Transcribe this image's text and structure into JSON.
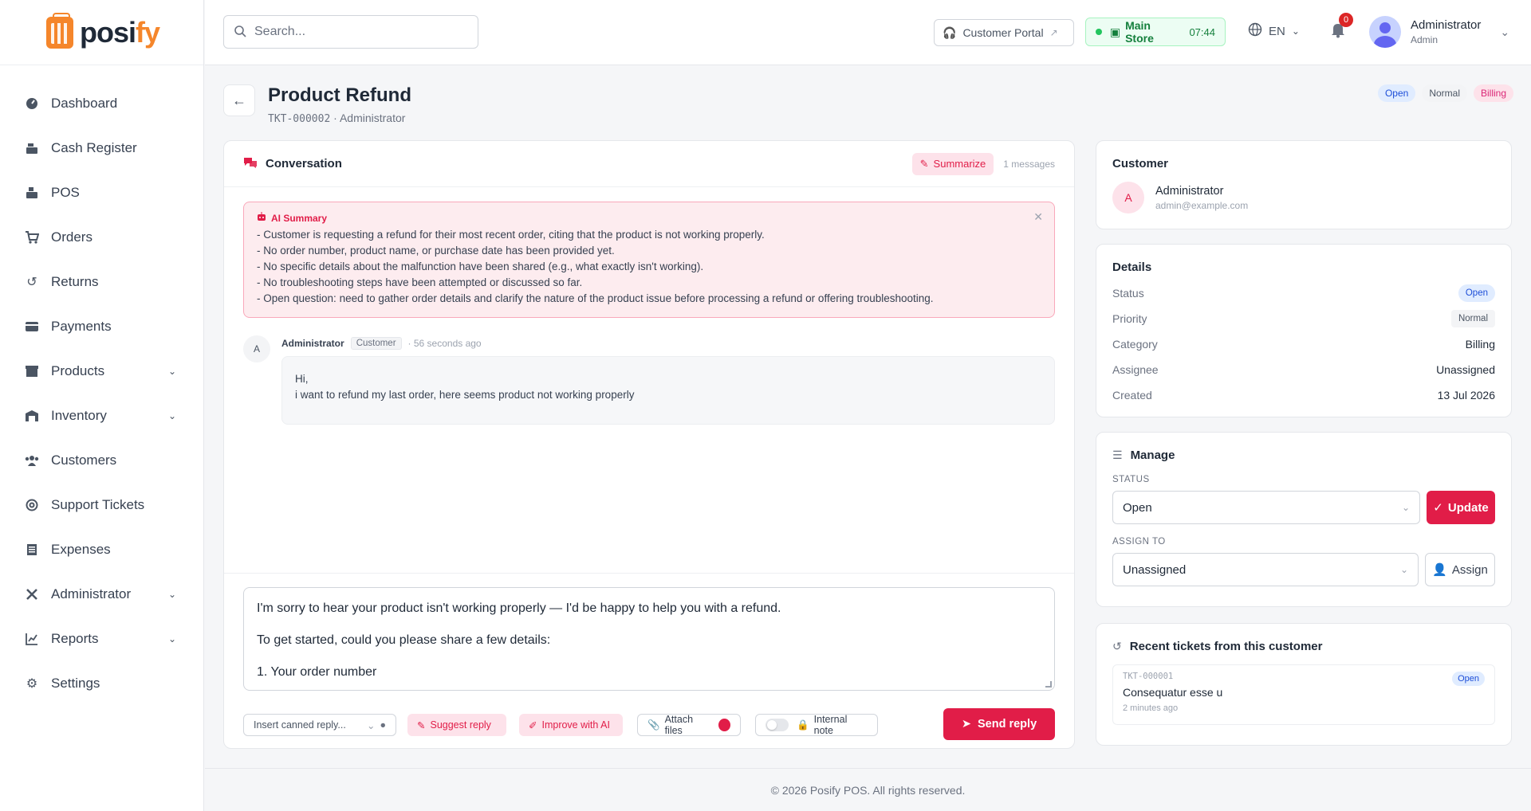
{
  "brand": {
    "name_main": "posi",
    "name_accent": "fy"
  },
  "sidebar": {
    "items": [
      {
        "label": "Dashboard",
        "icon": "dashboard-icon",
        "chevron": false
      },
      {
        "label": "Cash Register",
        "icon": "cash-register-icon",
        "chevron": false
      },
      {
        "label": "POS",
        "icon": "pos-icon",
        "chevron": false
      },
      {
        "label": "Orders",
        "icon": "cart-icon",
        "chevron": false
      },
      {
        "label": "Returns",
        "icon": "return-icon",
        "chevron": false
      },
      {
        "label": "Payments",
        "icon": "credit-card-icon",
        "chevron": false
      },
      {
        "label": "Products",
        "icon": "box-icon",
        "chevron": true
      },
      {
        "label": "Inventory",
        "icon": "warehouse-icon",
        "chevron": true
      },
      {
        "label": "Customers",
        "icon": "users-icon",
        "chevron": false
      },
      {
        "label": "Support Tickets",
        "icon": "lifebuoy-icon",
        "chevron": false
      },
      {
        "label": "Expenses",
        "icon": "receipt-icon",
        "chevron": false
      },
      {
        "label": "Administrator",
        "icon": "tools-icon",
        "chevron": true
      },
      {
        "label": "Reports",
        "icon": "chart-line-icon",
        "chevron": true
      },
      {
        "label": "Settings",
        "icon": "gears-icon",
        "chevron": false
      }
    ]
  },
  "topbar": {
    "search_placeholder": "Search...",
    "customer_portal": "Customer Portal",
    "store_name": "Main Store",
    "store_time": "07:44",
    "language": "EN",
    "notification_count": "0",
    "user_name": "Administrator",
    "user_role": "Admin"
  },
  "ticket": {
    "title": "Product Refund",
    "id": "TKT-000002",
    "sub_sep": " · ",
    "owner": "Administrator",
    "badges": {
      "status": "Open",
      "priority": "Normal",
      "category": "Billing"
    }
  },
  "conversation": {
    "title": "Conversation",
    "summarize_label": "Summarize",
    "message_count": "1 messages",
    "ai_summary": {
      "title": "AI Summary",
      "lines": [
        "- Customer is requesting a refund for their most recent order, citing that the product is not working properly.",
        "- No order number, product name, or purchase date has been provided yet.",
        "- No specific details about the malfunction have been shared (e.g., what exactly isn't working).",
        "- No troubleshooting steps have been attempted or discussed so far.",
        "- Open question: need to gather order details and clarify the nature of the product issue before processing a refund or offering troubleshooting."
      ]
    },
    "message": {
      "avatar_initial": "A",
      "author": "Administrator",
      "role_tag": "Customer",
      "time": "· 56 seconds ago",
      "line1": "Hi,",
      "line2": "i want to refund my last order, here seems product not working properly"
    },
    "reply": {
      "line1": "I'm sorry to hear your product isn't working properly — I'd be happy to help you with a refund.",
      "line2": "To get started, could you please share a few details:",
      "line3": "1. Your order number"
    },
    "actions": {
      "canned": "Insert canned reply...",
      "suggest": "Suggest reply",
      "improve": "Improve with AI",
      "attach": "Attach files",
      "internal_note": "Internal note",
      "send": "Send reply"
    }
  },
  "customer": {
    "title": "Customer",
    "initial": "A",
    "name": "Administrator",
    "email": "admin@example.com"
  },
  "details": {
    "title": "Details",
    "status_label": "Status",
    "status_value": "Open",
    "priority_label": "Priority",
    "priority_value": "Normal",
    "category_label": "Category",
    "category_value": "Billing",
    "assignee_label": "Assignee",
    "assignee_value": "Unassigned",
    "created_label": "Created",
    "created_value": "13 Jul 2026"
  },
  "manage": {
    "title": "Manage",
    "status_label": "STATUS",
    "status_value": "Open",
    "update_label": "Update",
    "assign_label": "ASSIGN TO",
    "assign_value": "Unassigned",
    "assign_button": "Assign"
  },
  "recent": {
    "title": "Recent tickets from this customer",
    "items": [
      {
        "id": "TKT-000001",
        "subject": "Consequatur esse u",
        "time": "2 minutes ago",
        "status": "Open"
      }
    ]
  },
  "footer": {
    "text": "© 2026 Posify POS. All rights reserved."
  },
  "colors": {
    "accent": "#e11d48",
    "brand_orange": "#f5862b",
    "open_blue": "#1d4ed8",
    "store_green": "#15803d"
  }
}
